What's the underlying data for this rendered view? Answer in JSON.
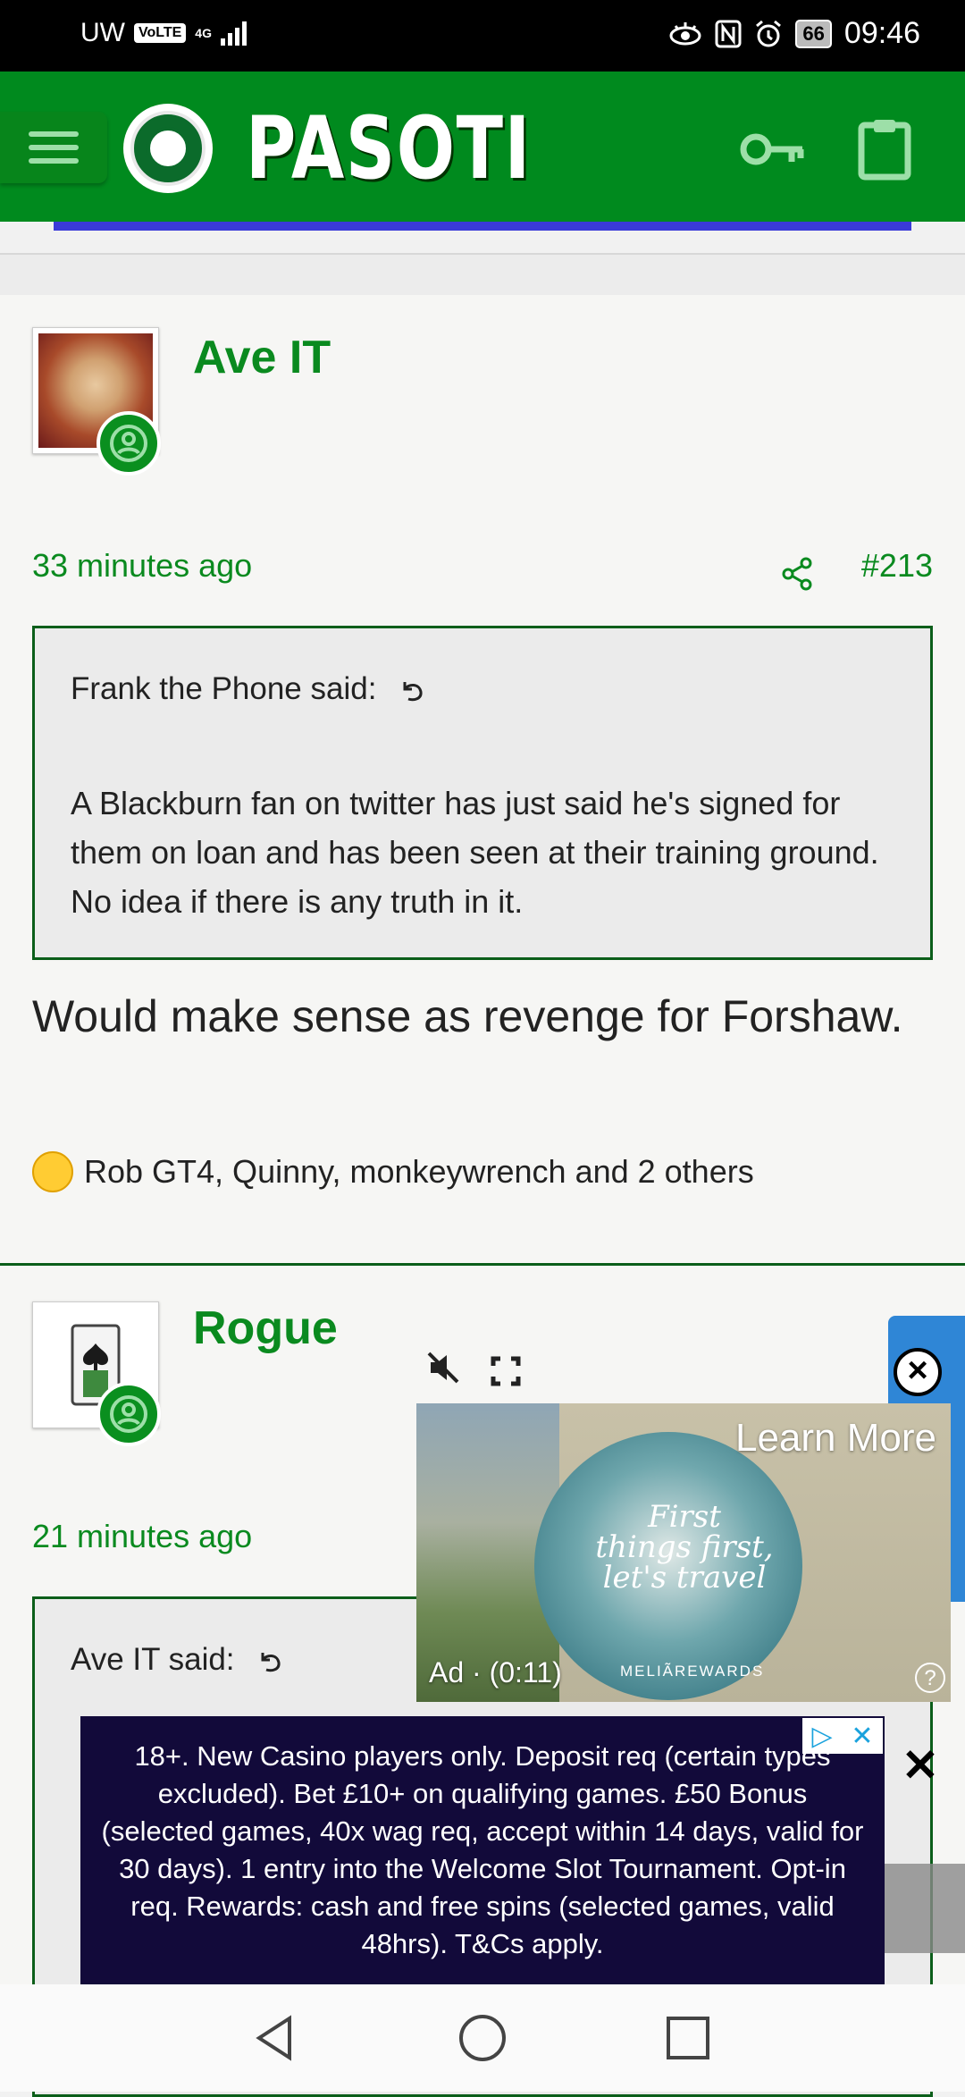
{
  "status_bar": {
    "carrier": "UW",
    "volte": "VoLTE",
    "network": "4G",
    "battery": "66",
    "time": "09:46"
  },
  "header": {
    "site_name": "PASOTI",
    "menu_icon": "hamburger-icon",
    "login_icon": "key-icon",
    "register_icon": "clipboard-icon"
  },
  "posts": [
    {
      "username": "Ave IT",
      "time_ago": "33 minutes ago",
      "post_number": "#213",
      "quote_author": "Frank the Phone said:",
      "quote_text": "A Blackburn fan on twitter has just said he's signed for them on loan and has been seen at their training ground. No idea if there is any truth in it.",
      "body": "Would make sense as revenge for Forshaw.",
      "reactions": "Rob GT4, Quinny, monkeywrench and 2 others"
    },
    {
      "username": "Rogue",
      "time_ago": "21 minutes ago",
      "quote_author": "Ave IT said:"
    }
  ],
  "video_ad": {
    "learn_more": "Learn More",
    "ad_label": "Ad · (0:11)",
    "headline": "First things first, let's travel",
    "brand": "MELIÃREWARDS",
    "help": "?"
  },
  "banner_ad": {
    "text": "18+. New Casino players only. Deposit req (certain types excluded). Bet £10+ on qualifying games. £50 Bonus (selected games, 40x wag req, accept within 14 days, valid for 30 days). 1 entry into the Welcome Slot Tournament. Opt-in req. Rewards: cash and free spins (selected games, valid 48hrs). T&Cs apply."
  },
  "colors": {
    "header_green": "#008a1e",
    "link_green": "#0a8a1f",
    "border_green": "#0b5e1a",
    "accent_blue": "#3a3ad8"
  }
}
